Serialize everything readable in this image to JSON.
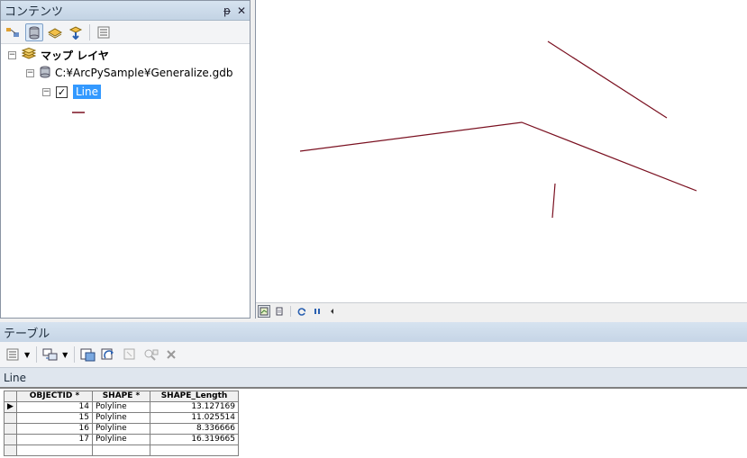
{
  "toc": {
    "title": "コンテンツ",
    "pin_glyph": "ᵽ",
    "close_glyph": "✕",
    "toolbar_icons": [
      "list-by-drawing-order-icon",
      "list-by-source-icon",
      "list-by-visibility-icon",
      "list-by-selection-icon",
      "options-icon"
    ],
    "tree": {
      "map_layers_label": "マップ レイヤ",
      "gdb_label": "C:¥ArcPySample¥Generalize.gdb",
      "layer_label": "Line",
      "layer_checked": true
    }
  },
  "map": {
    "line_color": "#7a1020",
    "footer_icons": [
      "data-view-icon",
      "layout-view-icon",
      "refresh-icon",
      "pause-icon",
      "scroll-left-icon"
    ]
  },
  "table_window": {
    "title": "テーブル",
    "tab_label": "Line",
    "columns": [
      "OBJECTID *",
      "SHAPE *",
      "SHAPE_Length"
    ],
    "rows": [
      {
        "objectid": "14",
        "shape": "Polyline",
        "length": "13.127169"
      },
      {
        "objectid": "15",
        "shape": "Polyline",
        "length": "11.025514"
      },
      {
        "objectid": "16",
        "shape": "Polyline",
        "length": "8.336666"
      },
      {
        "objectid": "17",
        "shape": "Polyline",
        "length": "16.319665"
      }
    ]
  }
}
